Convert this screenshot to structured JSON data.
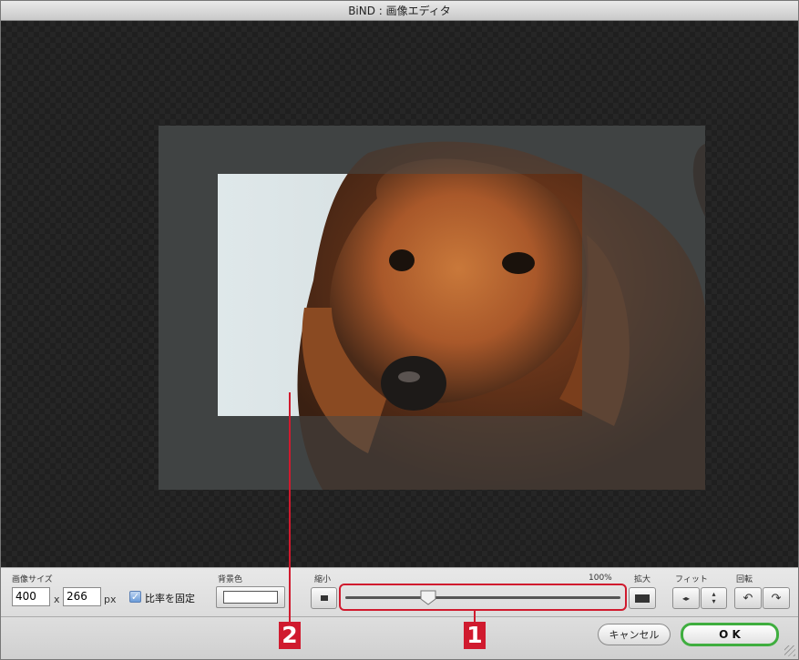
{
  "window": {
    "title": "BiND : 画像エディタ"
  },
  "image_size": {
    "label": "画像サイズ",
    "width": "400",
    "x": "x",
    "height": "266",
    "unit": "px"
  },
  "ratio": {
    "label": "比率を固定",
    "checked": true
  },
  "bg_color": {
    "label": "背景色",
    "value": "#ffffff"
  },
  "zoom": {
    "shrink_label": "縮小",
    "enlarge_label": "拡大",
    "percent": "100%",
    "level": 0.3
  },
  "fit": {
    "label": "フィット"
  },
  "rotate": {
    "label": "回転"
  },
  "footer": {
    "cancel": "キャンセル",
    "ok": "O K"
  },
  "callouts": {
    "one": "1",
    "two": "2"
  },
  "colors": {
    "accent": "#d01a2e",
    "ok_border": "#3fae3f"
  }
}
